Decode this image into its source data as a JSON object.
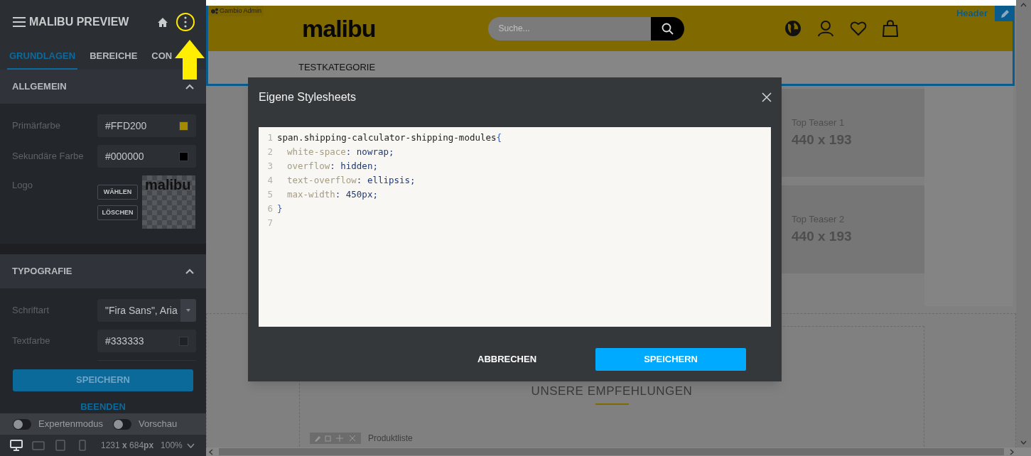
{
  "sidebar": {
    "title": "MALIBU PREVIEW",
    "tabs": [
      {
        "label": "GRUNDLAGEN",
        "selected": true
      },
      {
        "label": "BEREICHE",
        "selected": false
      },
      {
        "label": "CON",
        "selected": false
      }
    ],
    "sections": [
      {
        "title": "ALLGEMEIN",
        "expanded": true,
        "fields": [
          {
            "kind": "color",
            "label": "Primärfarbe",
            "value": "#FFD200",
            "color": "#a38a00"
          },
          {
            "kind": "color",
            "label": "Sekundäre Farbe",
            "value": "#000000",
            "color": "#000000"
          },
          {
            "kind": "logo",
            "label": "Logo",
            "buttons": [
              "WÄHLEN",
              "LÖSCHEN"
            ],
            "logo_text": "malibu"
          }
        ]
      },
      {
        "title": "TYPOGRAFIE",
        "expanded": true,
        "fields": [
          {
            "kind": "select",
            "label": "Schriftart",
            "value": "\"Fira Sans\", Aria"
          },
          {
            "kind": "color",
            "label": "Textfarbe",
            "value": "#333333",
            "color": "#1f2226"
          }
        ]
      }
    ],
    "save_button": "SPEICHERN",
    "exit_link": "BEENDEN",
    "toggles": [
      {
        "label": "Expertenmodus",
        "on": false
      },
      {
        "label": "Vorschau",
        "on": false
      }
    ],
    "devices": [
      {
        "kind": "desktop",
        "selected": true
      },
      {
        "kind": "tablet-landscape",
        "selected": false
      },
      {
        "kind": "tablet",
        "selected": false
      },
      {
        "kind": "phone",
        "selected": false
      }
    ],
    "resolution": "1231 **x** 684**px**",
    "zoom": "100%"
  },
  "preview": {
    "admin_badge": "Gambio Admin",
    "logo": "malibu",
    "search": {
      "placeholder": "Suche..."
    },
    "nav": [
      "TESTKATEGORIE"
    ],
    "section_label": "Header",
    "teasers": [
      {
        "title": "Top Teaser 1",
        "size": "440 x 193"
      },
      {
        "title": "Top Teaser 2",
        "size": "440 x 193"
      }
    ],
    "heading": "UNSERE EMPFEHLUNGEN",
    "module_label": "Produktliste"
  },
  "dialog": {
    "title": "Eigene Stylesheets",
    "code_lines": [
      {
        "number": "1",
        "kind": "selector",
        "text": "span.shipping-calculator-shipping-modules",
        "brace": "{"
      },
      {
        "number": "2",
        "kind": "declaration",
        "property": "white-space",
        "value": ": nowrap;"
      },
      {
        "number": "3",
        "kind": "declaration",
        "property": "overflow",
        "value": ": hidden;"
      },
      {
        "number": "4",
        "kind": "declaration",
        "property": "text-overflow",
        "value": ": ellipsis;"
      },
      {
        "number": "5",
        "kind": "declaration",
        "property": "max-width",
        "value": ": 450px;"
      },
      {
        "number": "6",
        "kind": "close",
        "brace": "}"
      },
      {
        "number": "7",
        "kind": "empty"
      }
    ],
    "buttons": [
      {
        "label": "ABBRECHEN",
        "kind": "secondary"
      },
      {
        "label": "SPEICHERN",
        "kind": "primary"
      }
    ]
  }
}
